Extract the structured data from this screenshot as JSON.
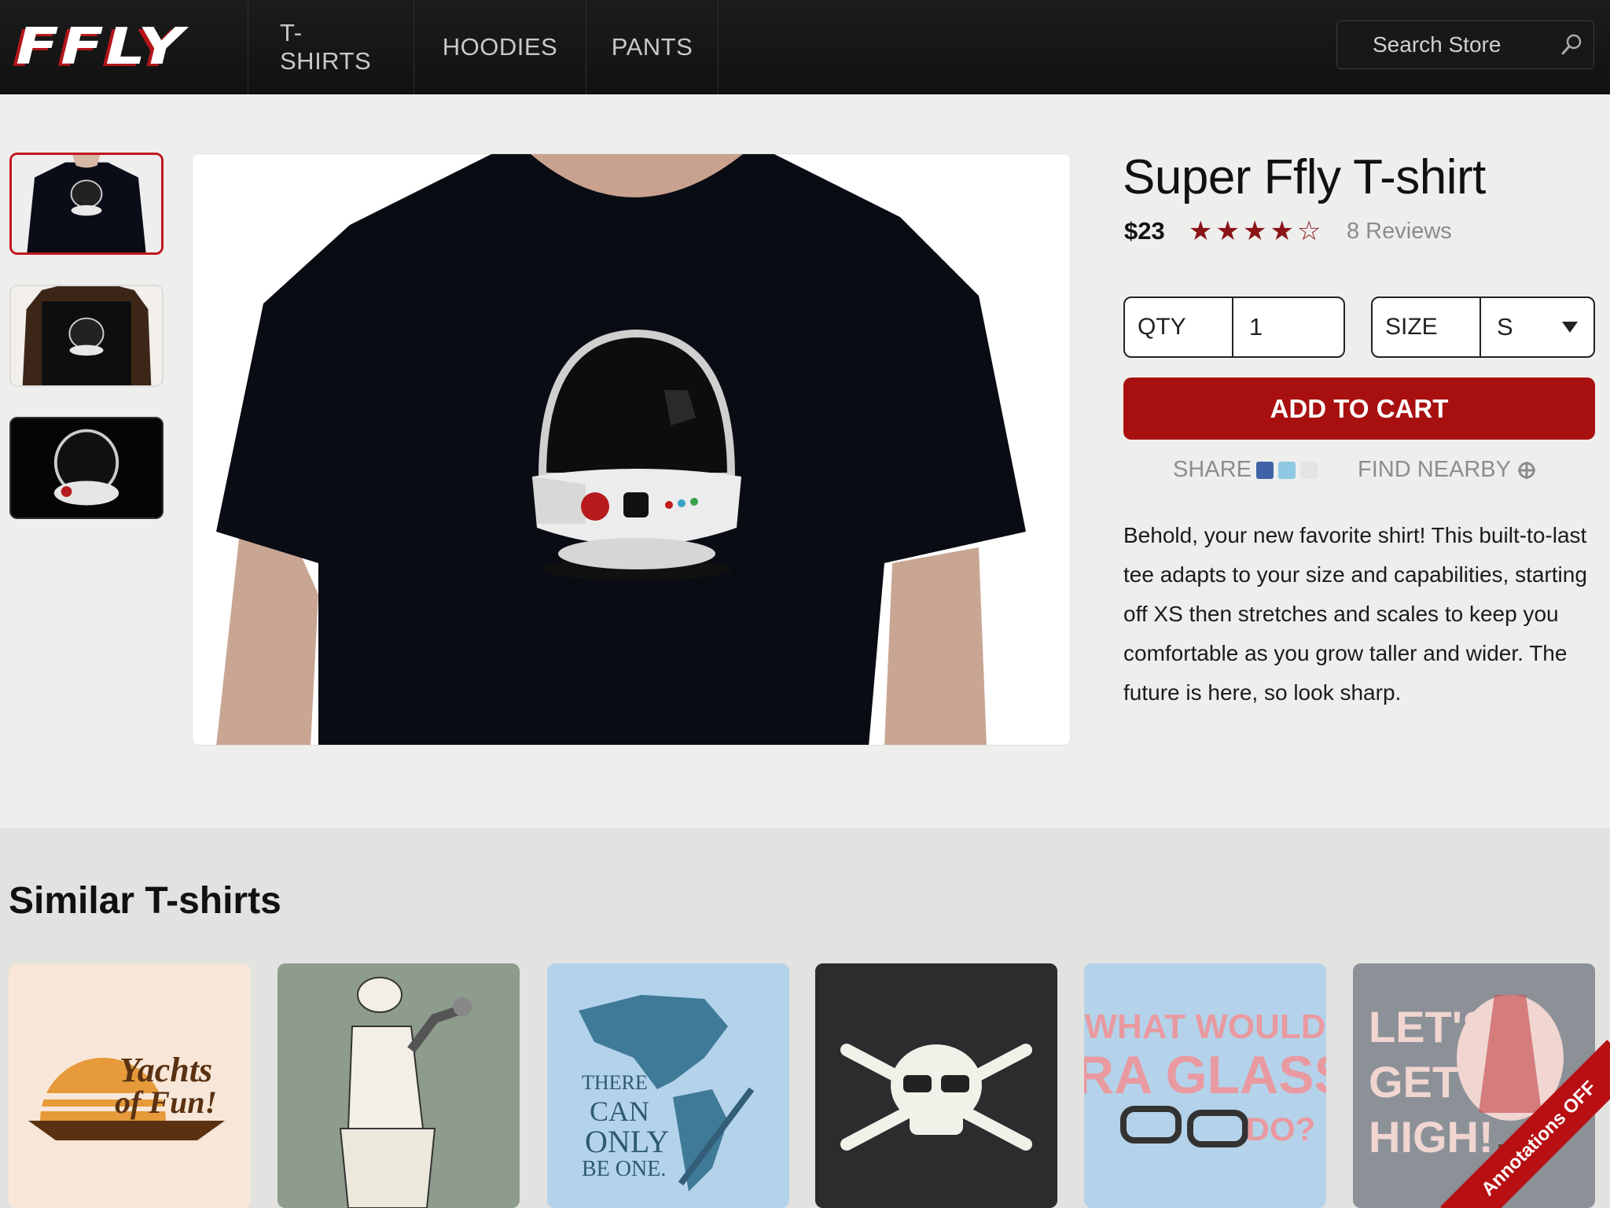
{
  "header": {
    "logo": "FFLY",
    "nav": [
      {
        "label": "T-SHIRTS"
      },
      {
        "label": "HOODIES"
      },
      {
        "label": "PANTS"
      }
    ],
    "search_placeholder": "Search Store"
  },
  "product": {
    "title": "Super Ffly T-shirt",
    "price": "$23",
    "rating": 4,
    "rating_max": 5,
    "reviews": "8 Reviews",
    "qty_label": "QTY",
    "qty_value": "1",
    "size_label": "SIZE",
    "size_value": "S",
    "add_to_cart": "ADD TO CART",
    "share_label": "SHARE",
    "find_nearby": "FIND NEARBY",
    "description": "Behold, your new favorite shirt! This built-to-last tee adapts to your size and capabilities, starting off XS then stretches and scales to keep you comfortable as you grow taller and wider. The future is here, so look sharp."
  },
  "similar": {
    "title": "Similar T-shirts",
    "items": [
      {
        "name": "yachts-of-fun",
        "line1": "Yachts",
        "line2": "of Fun!"
      },
      {
        "name": "venus-robot"
      },
      {
        "name": "there-can-only-be-one",
        "text": "THERE CAN ONLY BE ONE."
      },
      {
        "name": "skull-crossbones"
      },
      {
        "name": "ira-glass",
        "text": "WHAT WOULD IRA GLASS DO?"
      },
      {
        "name": "lets-get-high",
        "text": "LET'S GET HIGH!"
      }
    ]
  },
  "annotations_badge": "Annotations OFF",
  "colors": {
    "brand_red": "#a8100f",
    "star_red": "#8a1418",
    "nav_bg": "#151515"
  }
}
